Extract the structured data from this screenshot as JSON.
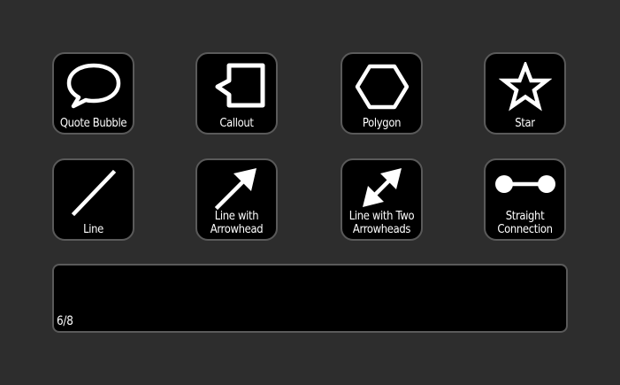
{
  "shapes": [
    {
      "name": "quote-bubble",
      "label": "Quote Bubble"
    },
    {
      "name": "callout",
      "label": "Callout"
    },
    {
      "name": "polygon",
      "label": "Polygon"
    },
    {
      "name": "star",
      "label": "Star"
    },
    {
      "name": "line",
      "label": "Line"
    },
    {
      "name": "line-with-arrowhead",
      "label": "Line with\nArrowhead"
    },
    {
      "name": "line-with-two-arrowheads",
      "label": "Line with Two\nArrowheads"
    },
    {
      "name": "straight-connection",
      "label": "Straight\nConnection"
    }
  ],
  "panel": {
    "page_indicator": "6/8"
  }
}
